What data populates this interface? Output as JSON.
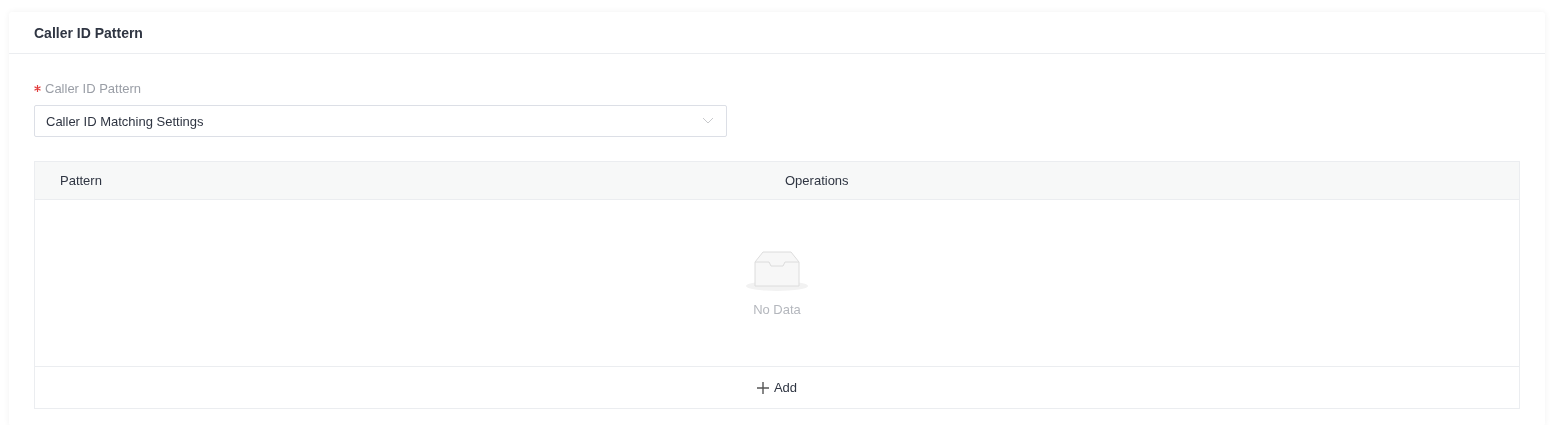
{
  "card": {
    "title": "Caller ID Pattern"
  },
  "field": {
    "label": "Caller ID Pattern",
    "required": true,
    "value": "Caller ID Matching Settings"
  },
  "table": {
    "columns": [
      "Pattern",
      "Operations"
    ],
    "empty_text": "No Data",
    "add_button": {
      "label": "Add"
    }
  }
}
